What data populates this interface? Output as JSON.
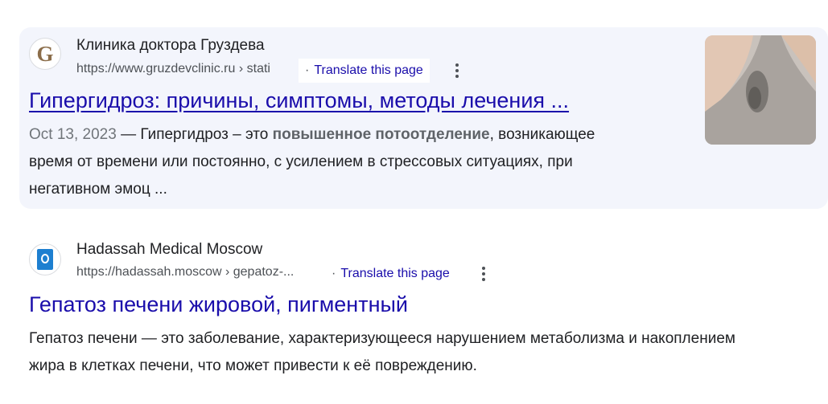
{
  "results": [
    {
      "site_name": "Клиника доктора Груздева",
      "url": "https://www.gruzdevclinic.ru › stati",
      "translate_dot": "·",
      "translate_label": "Translate this page",
      "title": "Гипергидроз: причины, симптомы, методы лечения ...",
      "date": "Oct 13, 2023",
      "snippet_before": " — Гипергидроз – это ",
      "snippet_bold": "повышенное потоотделение",
      "snippet_line1_after": ", возникающее",
      "snippet_line2": "время от времени или постоянно, с усилением в стрессовых ситуациях, при",
      "snippet_line3": "негативном эмоц ...",
      "favicon_icon": "g-letter-icon",
      "thumbnail_icon": "underarm-sweat-photo"
    },
    {
      "site_name": "Hadassah Medical Moscow",
      "url": "https://hadassah.moscow › gepatoz-...",
      "translate_dot": "·",
      "translate_label": "Translate this page",
      "title": "Гепатоз печени жировой, пигментный",
      "snippet_line1": "Гепатоз печени — это заболевание, характеризующееся нарушением метаболизма и накоплением",
      "snippet_line2": "жира в клетках печени, что может привести к её повреждению.",
      "favicon_icon": "hadassah-logo-icon"
    }
  ],
  "colors": {
    "link": "#1a0dab",
    "highlight_card": "#f3f5fc",
    "url_gray": "#4d5156"
  }
}
